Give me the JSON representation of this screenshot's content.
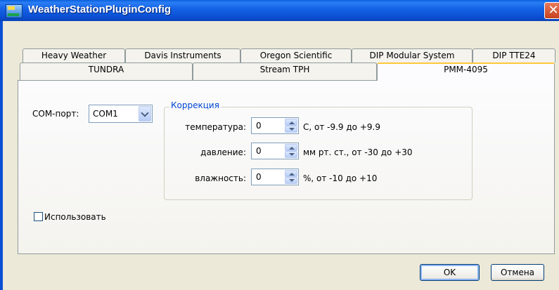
{
  "window": {
    "title": "WeatherStationPluginConfig"
  },
  "tabs_row1": [
    "Heavy Weather",
    "Davis Instruments",
    "Oregon Scientific",
    "DIP Modular System",
    "DIP TTE24"
  ],
  "tabs_row2": [
    "TUNDRA",
    "Stream TPH",
    "PMM-4095"
  ],
  "active_tab": "PMM-4095",
  "com": {
    "label": "COM-порт:",
    "value": "COM1"
  },
  "correction": {
    "title": "Коррекция",
    "rows": [
      {
        "label": "температура:",
        "value": "0",
        "hint": "C, от -9.9 до +9.9"
      },
      {
        "label": "давление:",
        "value": "0",
        "hint": "мм рт. ст., от -30 до +30"
      },
      {
        "label": "влажность:",
        "value": "0",
        "hint": "%, от -10 до +10"
      }
    ]
  },
  "use_checkbox": {
    "label": "Использовать",
    "checked": false
  },
  "buttons": {
    "ok": "OK",
    "cancel": "Отмена"
  },
  "colors": {
    "titlebar": "#0a5fdc",
    "accent_tab": "#ffc83c",
    "group_title": "#0046d5"
  }
}
